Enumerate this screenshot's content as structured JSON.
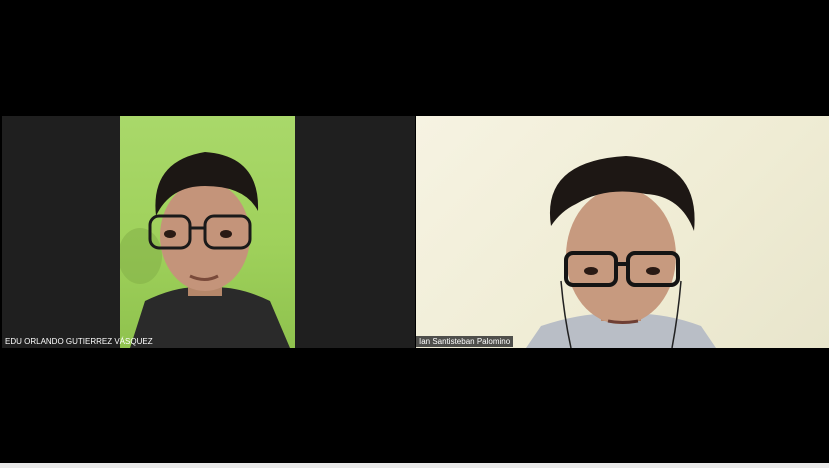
{
  "participants": [
    {
      "display_name": "EDU ORLANDO GUTIERREZ VÁSQUEZ",
      "video_on": true
    },
    {
      "display_name": "Ian Santisteban Palomino",
      "video_on": true
    }
  ],
  "colors": {
    "background": "#000000",
    "left_wall": "#a9d86a",
    "right_wall": "#f1efd9"
  }
}
